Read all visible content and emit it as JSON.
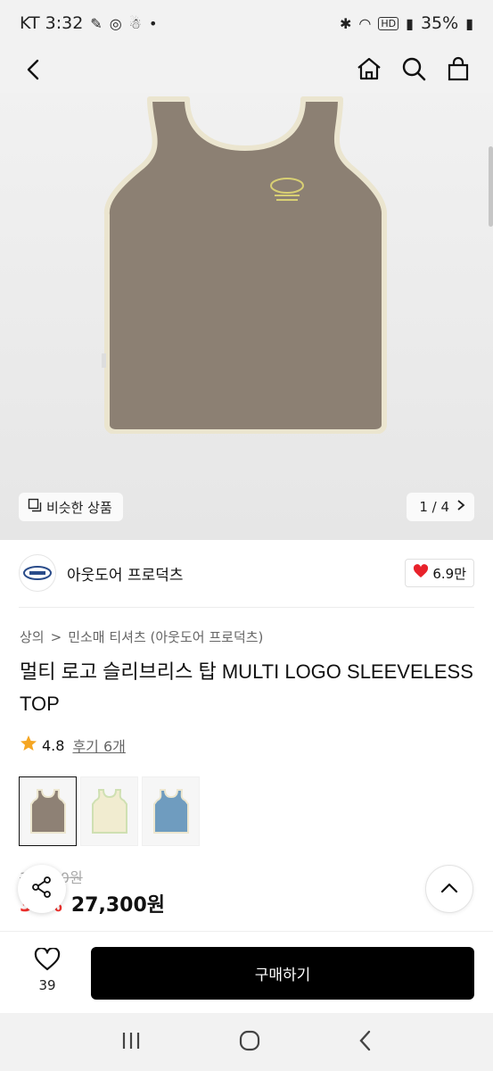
{
  "status_bar": {
    "time": "KT 3:32",
    "battery": "35%"
  },
  "gallery": {
    "similar_label": "비슷한 상품",
    "page_indicator": "1 / 4"
  },
  "brand": {
    "name": "아웃도어 프로덕츠",
    "likes": "6.9만"
  },
  "breadcrumb": {
    "category": "상의",
    "separator": ">",
    "subcategory": "민소매 티셔츠 (아웃도어 프로덕츠)"
  },
  "product": {
    "title": "멀티 로고 슬리브리스 탑 MULTI LOGO SLEEVELESS TOP",
    "rating": "4.8",
    "review_label": "후기 6개",
    "original_price": "39,000원",
    "discount": "30%",
    "price": "27,300원"
  },
  "swatches": [
    {
      "name": "brown",
      "color": "#8e8175",
      "trim": "#ece6cf"
    },
    {
      "name": "cream",
      "color": "#f1ecd0",
      "trim": "#cfe0b2"
    },
    {
      "name": "blue",
      "color": "#6f9cbf",
      "trim": "#ece6cf"
    }
  ],
  "bottom_bar": {
    "wish_count": "39",
    "buy_label": "구매하기"
  },
  "colors": {
    "accent_red": "#f0302c",
    "buy_button": "#000000"
  }
}
